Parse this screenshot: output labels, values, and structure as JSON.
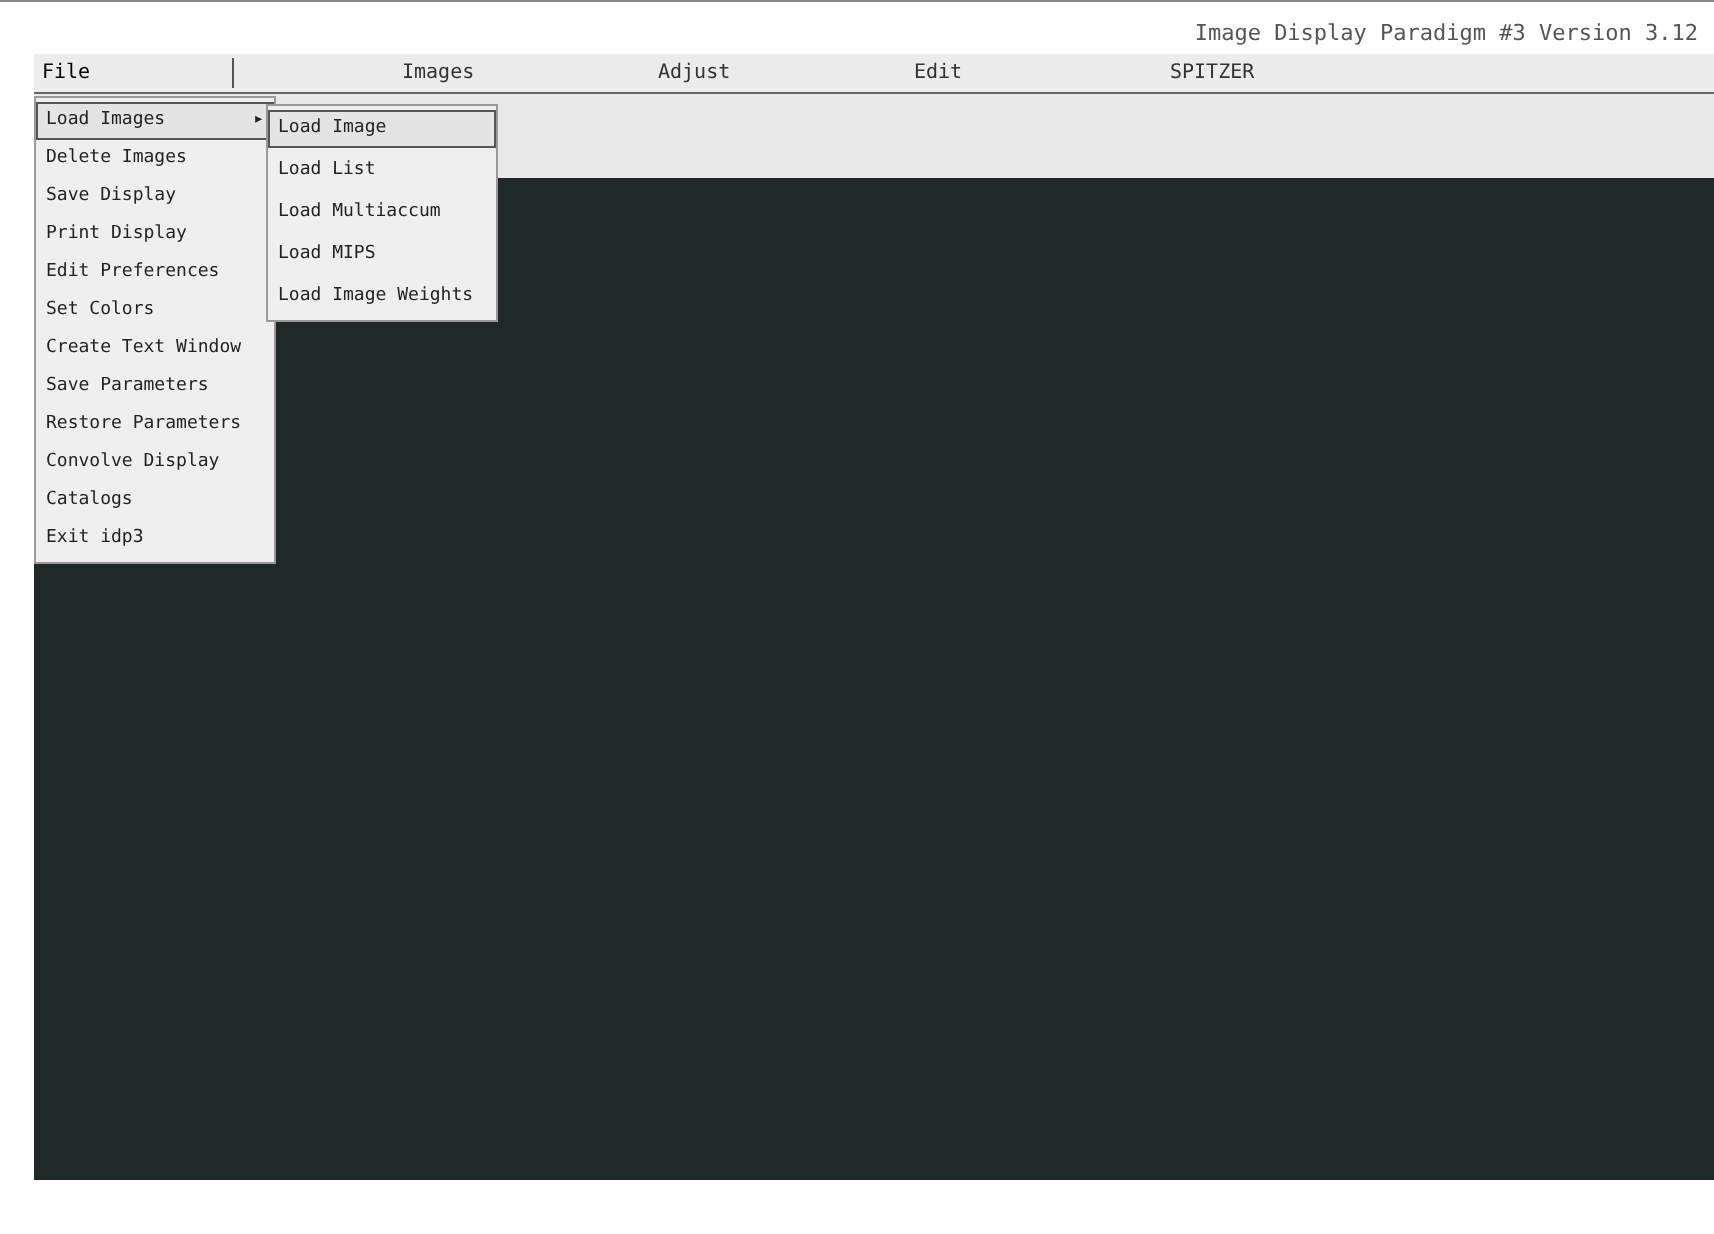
{
  "window": {
    "title": "Image Display Paradigm #3 Version 3.12"
  },
  "menubar": [
    {
      "label": "File",
      "selected": true
    },
    {
      "label": "Images",
      "selected": false
    },
    {
      "label": "Adjust",
      "selected": false
    },
    {
      "label": "Edit",
      "selected": false
    },
    {
      "label": "SPITZER",
      "selected": false
    }
  ],
  "file_menu": [
    {
      "label": "Load Images",
      "submenu": "▸",
      "selected": true
    },
    {
      "label": "Delete Images",
      "selected": false
    },
    {
      "label": "Save Display",
      "selected": false
    },
    {
      "label": "Print Display",
      "selected": false
    },
    {
      "label": "Edit Preferences",
      "selected": false
    },
    {
      "label": "Set Colors",
      "selected": false
    },
    {
      "label": "Create Text Window",
      "selected": false
    },
    {
      "label": "Save Parameters",
      "selected": false
    },
    {
      "label": "Restore Parameters",
      "selected": false
    },
    {
      "label": "Convolve Display",
      "selected": false
    },
    {
      "label": "Catalogs",
      "selected": false
    },
    {
      "label": "Exit idp3",
      "selected": false
    }
  ],
  "load_submenu": [
    {
      "label": "Load Image",
      "selected": true
    },
    {
      "label": "Load List",
      "selected": false
    },
    {
      "label": "Load Multiaccum",
      "selected": false
    },
    {
      "label": "Load MIPS",
      "selected": false
    },
    {
      "label": "Load Image Weights",
      "selected": false
    }
  ]
}
